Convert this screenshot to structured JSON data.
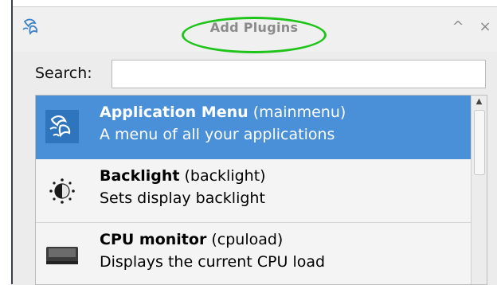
{
  "dialog": {
    "title": "Add Plugins",
    "app_icon": "pinwheel-logo-icon",
    "minimize_glyph": "^",
    "close_glyph": "×"
  },
  "search": {
    "label": "Search:",
    "value": "",
    "placeholder": ""
  },
  "plugins": [
    {
      "name": "Application Menu",
      "id": "(mainmenu)",
      "description": "A menu of all your applications",
      "icon": "app-menu-icon",
      "selected": true
    },
    {
      "name": "Backlight",
      "id": "(backlight)",
      "description": "Sets display backlight",
      "icon": "brightness-icon",
      "selected": false
    },
    {
      "name": "CPU monitor",
      "id": "(cpuload)",
      "description": "Displays the current CPU load",
      "icon": "cpu-chip-icon",
      "selected": false
    }
  ],
  "colors": {
    "selection": "#4a90d9",
    "highlight_ellipse": "#1fc41a"
  }
}
